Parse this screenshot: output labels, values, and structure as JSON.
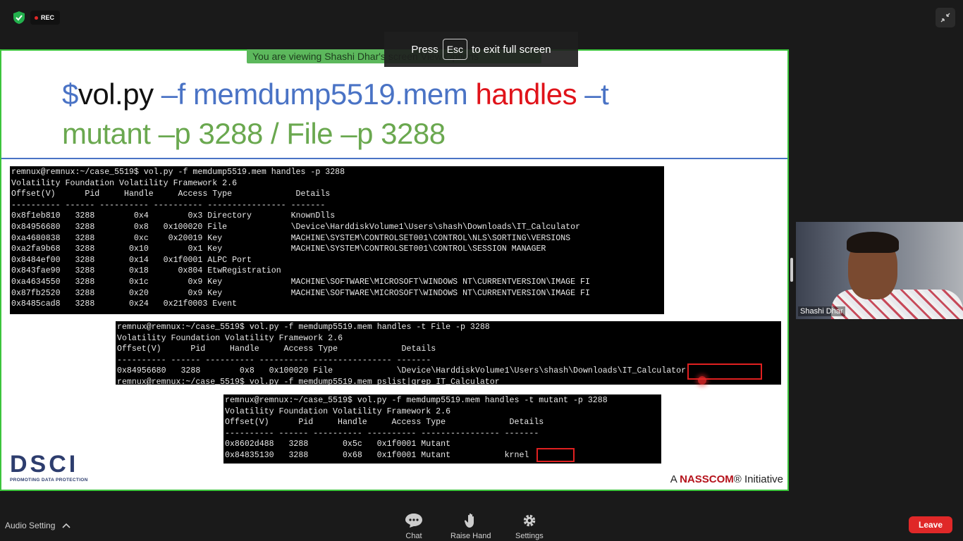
{
  "top_bar": {
    "rec_label": "REC",
    "shield_icon": "shield-check-icon",
    "exit_icon": "minimize-arrows-icon"
  },
  "notices": {
    "viewing_text": "You are viewing Shashi Dhar's screen   View Options",
    "esc_prefix": "Press",
    "esc_key": "Esc",
    "esc_suffix": "to exit full screen"
  },
  "slide": {
    "title_l1_a": "$",
    "title_l1_b": "vol.py ",
    "title_l1_c": "–f memdump5519.mem ",
    "title_l1_d": "handles",
    "title_l1_e": " –t",
    "title_l2": "mutant –p 3288 / File –p 3288",
    "terminal1": "remnux@remnux:~/case_5519$ vol.py -f memdump5519.mem handles -p 3288\nVolatility Foundation Volatility Framework 2.6\nOffset(V)      Pid     Handle     Access Type             Details\n---------- ------ ---------- ---------- ---------------- -------\n0x8f1eb810   3288        0x4        0x3 Directory        KnownDlls\n0x84956680   3288        0x8   0x100020 File             \\Device\\HarddiskVolume1\\Users\\shash\\Downloads\\IT_Calculator\n0xa4680838   3288        0xc    0x20019 Key              MACHINE\\SYSTEM\\CONTROLSET001\\CONTROL\\NLS\\SORTING\\VERSIONS\n0xa2fa9b68   3288       0x10        0x1 Key              MACHINE\\SYSTEM\\CONTROLSET001\\CONTROL\\SESSION MANAGER\n0x8484ef00   3288       0x14   0x1f0001 ALPC Port\n0x843fae90   3288       0x18      0x804 EtwRegistration\n0xa4634550   3288       0x1c        0x9 Key              MACHINE\\SOFTWARE\\MICROSOFT\\WINDOWS NT\\CURRENTVERSION\\IMAGE FI\n0x87fb2520   3288       0x20        0x9 Key              MACHINE\\SOFTWARE\\MICROSOFT\\WINDOWS NT\\CURRENTVERSION\\IMAGE FI\n0x8485cad8   3288       0x24   0x21f0003 Event",
    "terminal2": "remnux@remnux:~/case_5519$ vol.py -f memdump5519.mem handles -t File -p 3288\nVolatility Foundation Volatility Framework 2.6\nOffset(V)      Pid     Handle     Access Type             Details\n---------- ------ ---------- ---------- ---------------- -------\n0x84956680   3288        0x8   0x100020 File             \\Device\\HarddiskVolume1\\Users\\shash\\Downloads\\IT_Calculator\nremnux@remnux:~/case_5519$ vol.py -f memdump5519.mem pslist|grep IT_Calculator",
    "terminal3": "remnux@remnux:~/case_5519$ vol.py -f memdump5519.mem handles -t mutant -p 3288\nVolatility Foundation Volatility Framework 2.6\nOffset(V)      Pid     Handle     Access Type             Details\n---------- ------ ---------- ---------- ---------------- -------\n0x8602d488   3288       0x5c   0x1f0001 Mutant\n0x84835130   3288       0x68   0x1f0001 Mutant           krnel",
    "logo_text": "DSCI",
    "logo_tagline": "PROMOTING DATA PROTECTION",
    "footer_a": "A ",
    "footer_b": "NASSCOM",
    "footer_c": "® Initiative"
  },
  "participant": {
    "name": "Shashi Dhar"
  },
  "toolbar": {
    "audio_label": "Audio Setting",
    "chat_label": "Chat",
    "raise_hand_label": "Raise Hand",
    "settings_label": "Settings",
    "leave_label": "Leave"
  }
}
